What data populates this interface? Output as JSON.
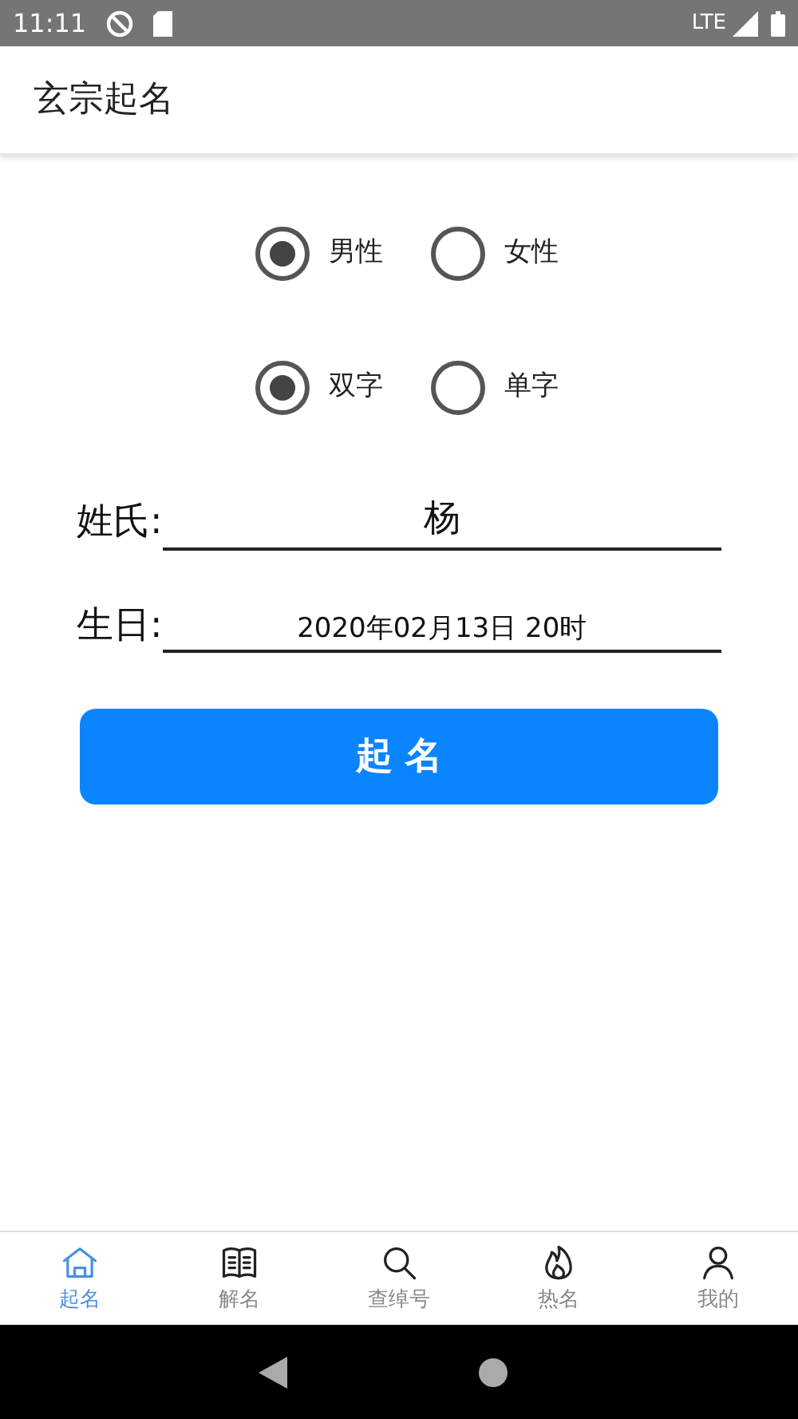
{
  "status_bar": {
    "time": "11:11",
    "network": "LTE"
  },
  "app_bar": {
    "title": "玄宗起名"
  },
  "gender": [
    {
      "label": "男性",
      "selected": true
    },
    {
      "label": "女性",
      "selected": false
    }
  ],
  "name_length": [
    {
      "label": "双字",
      "selected": true
    },
    {
      "label": "单字",
      "selected": false
    }
  ],
  "fields": [
    {
      "label": "姓氏:",
      "value": "杨",
      "kind": "surname"
    },
    {
      "label": "生日:",
      "value": "2020年02月13日 20时",
      "kind": "date"
    }
  ],
  "submit_button": "起 名",
  "bottom_nav": [
    {
      "label": "起名",
      "selected": true
    },
    {
      "label": "解名",
      "selected": false
    },
    {
      "label": "查绰号",
      "selected": false
    },
    {
      "label": "热名",
      "selected": false
    },
    {
      "label": "我的",
      "selected": false
    }
  ]
}
